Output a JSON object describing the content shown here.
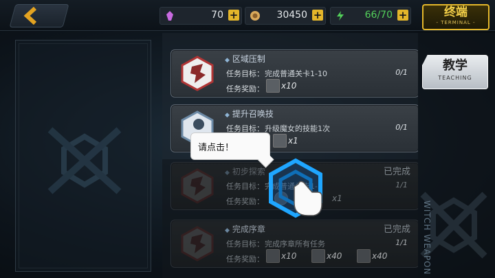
{
  "topbar": {
    "back_icon": "chevron-left-icon",
    "resources": [
      {
        "icon": "crystal-icon",
        "value": "70",
        "color": "#c86ae0"
      },
      {
        "icon": "coin-icon",
        "value": "30450",
        "color": "#d9a95b"
      },
      {
        "icon": "energy-icon",
        "value": "66/70",
        "color": "#53d05a"
      }
    ],
    "terminal_label": "终端",
    "terminal_sub": "- TERMINAL -"
  },
  "side_tab": {
    "label": "教学",
    "sub": "TEACHING"
  },
  "watermark_text": "WITCH WEAPON",
  "labels": {
    "goal": "任务目标：",
    "reward": "任务奖励："
  },
  "tasks": [
    {
      "title": "区域压制",
      "goal": "完成普通关卡1-10",
      "progress": "0/1",
      "status": "",
      "rewards": [
        {
          "icon": "scroll-icon",
          "amount": "x10"
        }
      ]
    },
    {
      "title": "提升召唤技",
      "goal": "升级魔女的技能1次",
      "progress": "0/1",
      "status": "",
      "rewards": [
        {
          "icon": "item-icon",
          "amount": "x1"
        }
      ]
    },
    {
      "title": "初步探索",
      "goal": "完成普通关卡1-3",
      "progress": "1/1",
      "status": "已完成",
      "rewards": [
        {
          "icon": "coin-icon",
          "amount": "x1"
        }
      ]
    },
    {
      "title": "完成序章",
      "goal": "完成序章所有任务",
      "progress": "1/1",
      "status": "已完成",
      "rewards": [
        {
          "icon": "scroll-icon",
          "amount": "x10"
        },
        {
          "icon": "item-icon",
          "amount": "x40"
        },
        {
          "icon": "item-icon",
          "amount": "x40"
        }
      ]
    }
  ],
  "tutorial": {
    "bubble": "请点击！",
    "pointer_icon": "hand-pointer-icon"
  },
  "colors": {
    "accent": "#e5b82a",
    "highlight": "#1fa6ff",
    "card_border": "#5d6670"
  }
}
